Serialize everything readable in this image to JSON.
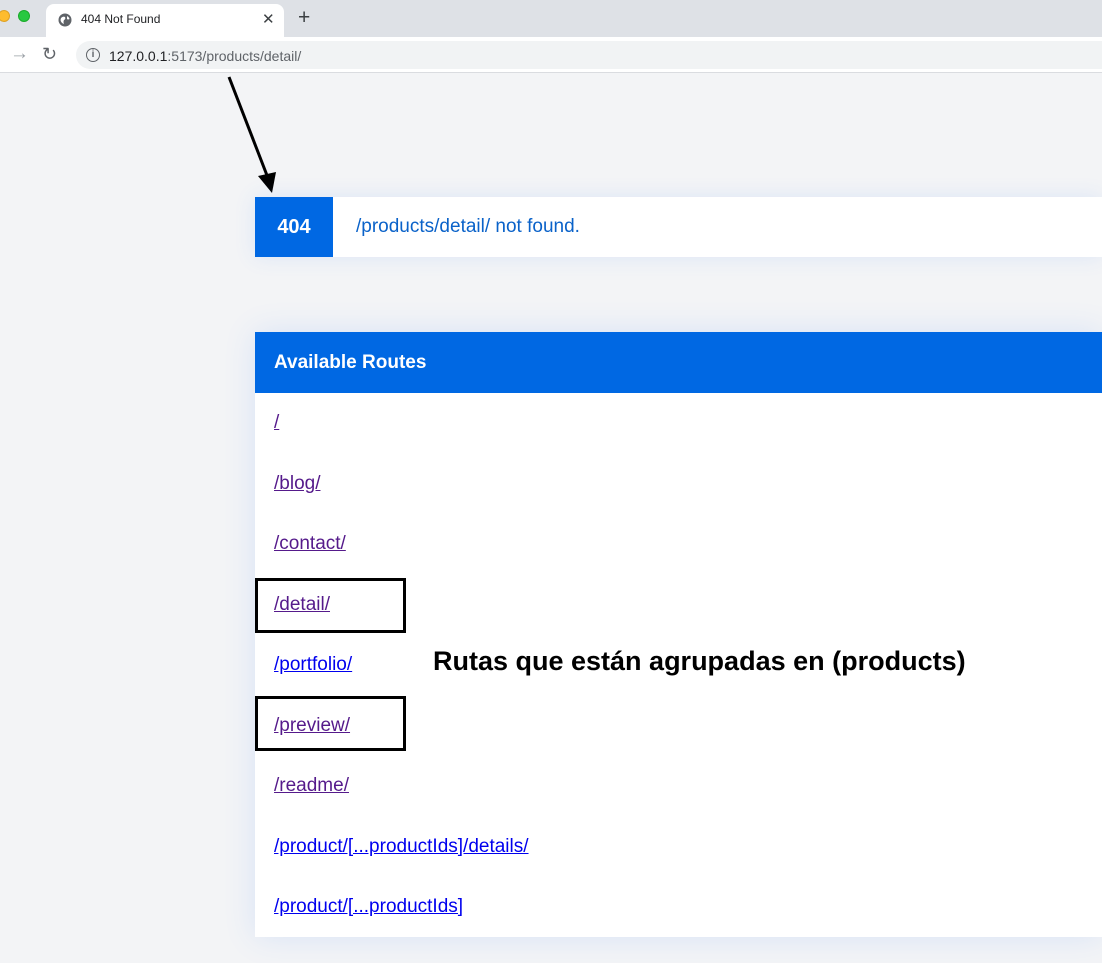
{
  "browser": {
    "tab_title": "404 Not Found",
    "url_host": "127.0.0.1",
    "url_rest": ":5173/products/detail/"
  },
  "error": {
    "code": "404",
    "message": "/products/detail/ not found."
  },
  "routes": {
    "heading": "Available Routes",
    "items": [
      {
        "label": "/",
        "visited": true
      },
      {
        "label": "/blog/",
        "visited": true
      },
      {
        "label": "/contact/",
        "visited": true
      },
      {
        "label": "/detail/",
        "visited": true
      },
      {
        "label": "/portfolio/",
        "visited": false
      },
      {
        "label": "/preview/",
        "visited": true
      },
      {
        "label": "/readme/",
        "visited": true
      },
      {
        "label": "/product/[...productIds]/details/",
        "visited": false
      },
      {
        "label": "/product/[...productIds]",
        "visited": false
      }
    ]
  },
  "annotation": {
    "text": "Rutas que están agrupadas en (products)"
  },
  "colors": {
    "accent": "#0068e3",
    "visited_link": "#551a8b",
    "link": "#0000ee"
  }
}
